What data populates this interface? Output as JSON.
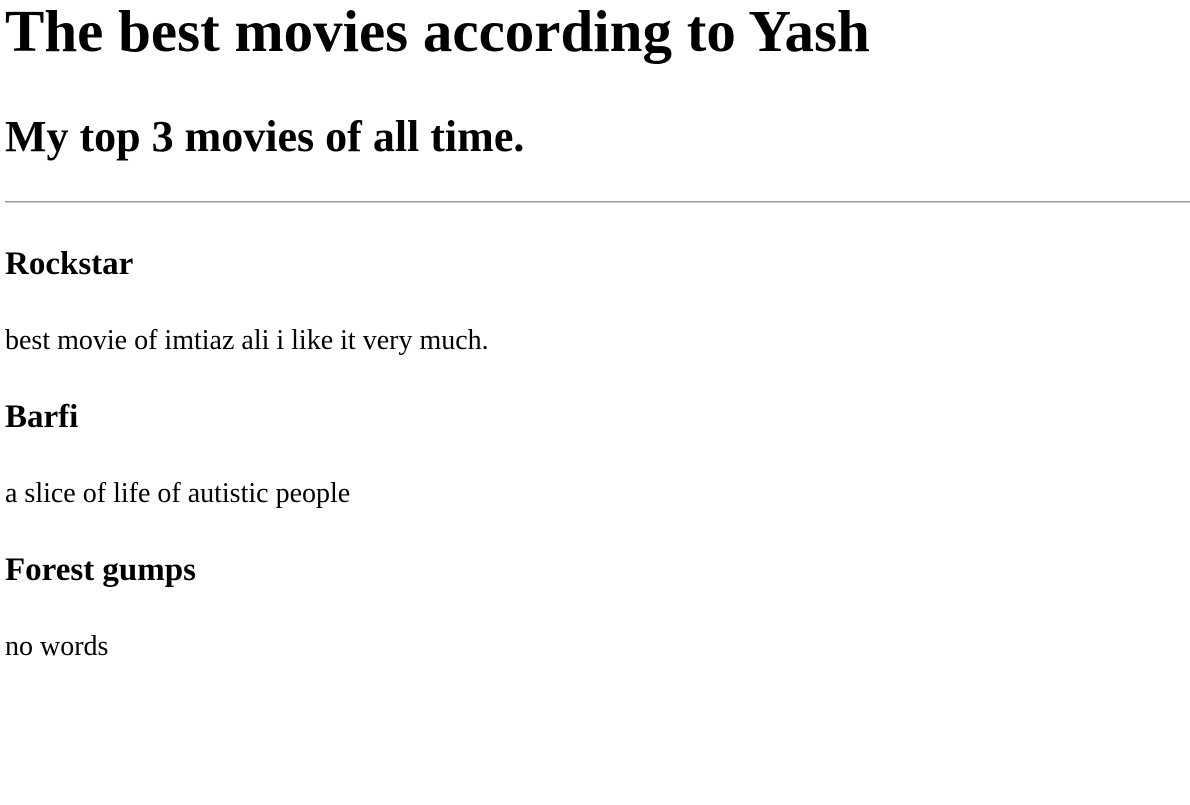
{
  "page": {
    "title": "The best movies according to Yash",
    "subtitle": "My top 3 movies of all time."
  },
  "movies": [
    {
      "title": "Rockstar",
      "description": "best movie of imtiaz ali i like it very much."
    },
    {
      "title": "Barfi",
      "description": "a slice of life of autistic people"
    },
    {
      "title": "Forest gumps",
      "description": "no words"
    }
  ]
}
